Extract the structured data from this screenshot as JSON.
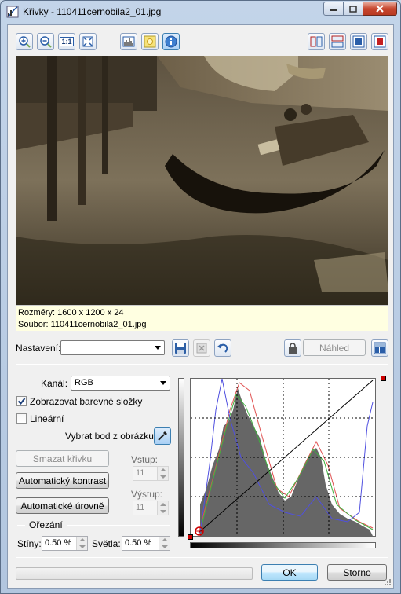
{
  "window": {
    "title": "Křivky - 110411cernobila2_01.jpg",
    "app_icon": "curves-icon",
    "caption_icons": [
      "minimize-icon",
      "maximize-icon",
      "close-icon"
    ]
  },
  "toolbar": {
    "left_icons": [
      "zoom-in-icon",
      "zoom-out-icon",
      "actual-size-icon",
      "fit-window-icon"
    ],
    "actual_size_text": "1:1",
    "mid_icons": [
      "histogram-icon",
      "highlight-icon",
      "info-icon"
    ],
    "right_icons": [
      "split-vertical-icon",
      "split-horizontal-icon",
      "original-view-icon",
      "result-view-icon"
    ]
  },
  "info": {
    "dimensions": "Rozměry: 1600 x 1200 x 24",
    "file": "Soubor: 110411cernobila2_01.jpg"
  },
  "presets": {
    "label": "Nastavení:",
    "value": "",
    "preview_button": "Náhled"
  },
  "curves": {
    "channel_label": "Kanál:",
    "channel_value": "RGB",
    "show_color_label": "Zobrazovat barevné složky",
    "show_color_checked": true,
    "linear_label": "Lineární",
    "linear_checked": false,
    "pick_label": "Vybrat bod z obrázku:",
    "delete_curve": "Smazat křivku",
    "auto_contrast": "Automatický kontrast",
    "auto_levels": "Automatické úrovně",
    "input_label": "Vstup:",
    "input_value": "11",
    "output_label": "Výstup:",
    "output_value": "11"
  },
  "clipping": {
    "label": "Ořezání",
    "shadows_label": "Stíny:",
    "shadows_value": "0.50 %",
    "highlights_label": "Světla:",
    "highlights_value": "0.50 %"
  },
  "footer": {
    "ok": "OK",
    "cancel": "Storno",
    "progress": 0
  },
  "colors": {
    "histogram_gray": "#666666",
    "channel_red": "#e05050",
    "channel_green": "#40b040",
    "channel_blue": "#5050e0",
    "point_red": "#cc0000"
  }
}
